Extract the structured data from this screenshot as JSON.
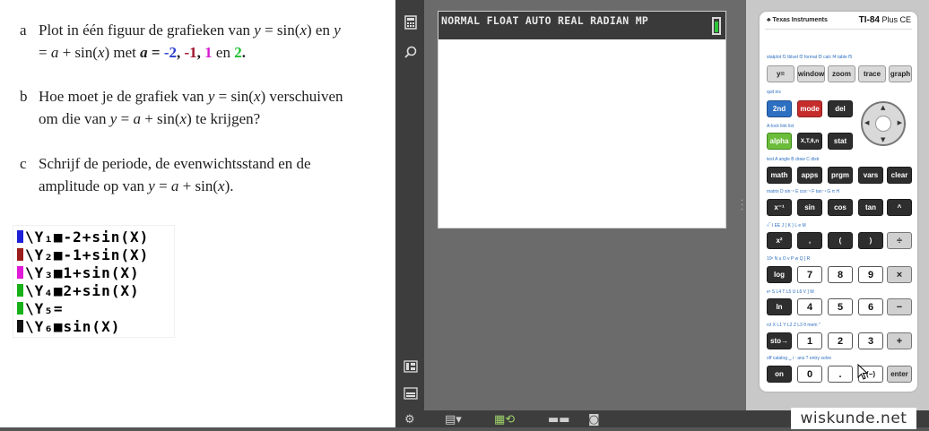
{
  "exercise": {
    "a": {
      "letter": "a",
      "l1_pre": "Plot in één figuur de grafieken van ",
      "y": "y",
      "l1_mid": " = sin(",
      "x": "x",
      "l1_post": ") en ",
      "l2_eq": " = ",
      "a": "a",
      "l2_mid": " + sin(",
      "l2_post": ") met ",
      "bold_eq": " = ",
      "v1": "-2",
      "c1": ", ",
      "v2": "-1",
      "c2": ", ",
      "v3": "1",
      "en": " en ",
      "v4": "2",
      "dot": "."
    },
    "b": {
      "letter": "b",
      "l1_pre": "Hoe moet je de grafiek van ",
      "l1_mid": " = sin(",
      "l1_post": ") verschuiven",
      "l2_pre": "om die van ",
      "l2_eq": " = ",
      "l2_mid": " + sin(",
      "l2_post": ") te krijgen?"
    },
    "c": {
      "letter": "c",
      "l1": "Schrijf de periode, de evenwichtsstand en de",
      "l2_pre": "amplitude op van ",
      "l2_eq": " = ",
      "l2_mid": " + sin(",
      "l2_post": ")."
    }
  },
  "y_editor": [
    {
      "text": "\\Y₁■-2+sin(X)",
      "color": "#1f1fd8"
    },
    {
      "text": "\\Y₂■-1+sin(X)",
      "color": "#9b1c1c"
    },
    {
      "text": "\\Y₃■1+sin(X)",
      "color": "#e01ad8"
    },
    {
      "text": "\\Y₄■2+sin(X)",
      "color": "#18b018"
    },
    {
      "text": "\\Y₅=",
      "color": "#18b018"
    },
    {
      "text": "\\Y₆■sin(X)",
      "color": "#111111"
    }
  ],
  "toolbar_icons": [
    "calculator-icon",
    "search-icon",
    "keypad-icon",
    "screen-icon"
  ],
  "screen": {
    "status": "NORMAL FLOAT AUTO REAL RADIAN MP"
  },
  "calculator": {
    "brand": "♣ Texas Instruments",
    "model": "TI-84",
    "model_suffix": " Plus CE",
    "row1_labels": "statplot f1  tblset f2  format f3  calc f4  table f5",
    "row1": [
      "y=",
      "window",
      "zoom",
      "trace",
      "graph"
    ],
    "row2_labels": "quit          ins",
    "row2": [
      "2nd",
      "mode",
      "del"
    ],
    "row3_labels": "A-lock   link       list",
    "row3": [
      "alpha",
      "X,T,θ,n",
      "stat"
    ],
    "row4_labels": "test A  angle B  draw C  distr",
    "row4": [
      "math",
      "apps",
      "prgm",
      "vars",
      "clear"
    ],
    "row5_labels": "matrix D  sin⁻¹ E  cos⁻¹ F  tan⁻¹ G  π H",
    "row5": [
      "x⁻¹",
      "sin",
      "cos",
      "tan",
      "^"
    ],
    "row6_labels": "√‾ I  EE J  { K  } L  e M",
    "row6": [
      "x²",
      ",",
      "(",
      ")",
      "÷"
    ],
    "row7_labels": "10ˣ N  u O  v P  w Q  [ R",
    "row7": [
      "log",
      "7",
      "8",
      "9",
      "×"
    ],
    "row8_labels": "eˣ S  L4 T  L5 U  L6 V  ] W",
    "row8": [
      "ln",
      "4",
      "5",
      "6",
      "−"
    ],
    "row9_labels": "rcl X  L1 Y  L2 Z  L3 θ  mem \"",
    "row9": [
      "sto→",
      "1",
      "2",
      "3",
      "+"
    ],
    "row10_labels": "off   catalog ␣  i  :  ans ?  entry solve",
    "row10": [
      "on",
      "0",
      ".",
      "(−)",
      "enter"
    ]
  },
  "bottom_icons": [
    "settings-icon",
    "calculator-view-icon",
    "mode-icon",
    "layout-icon",
    "camera-icon"
  ],
  "watermark": "wiskunde.net"
}
